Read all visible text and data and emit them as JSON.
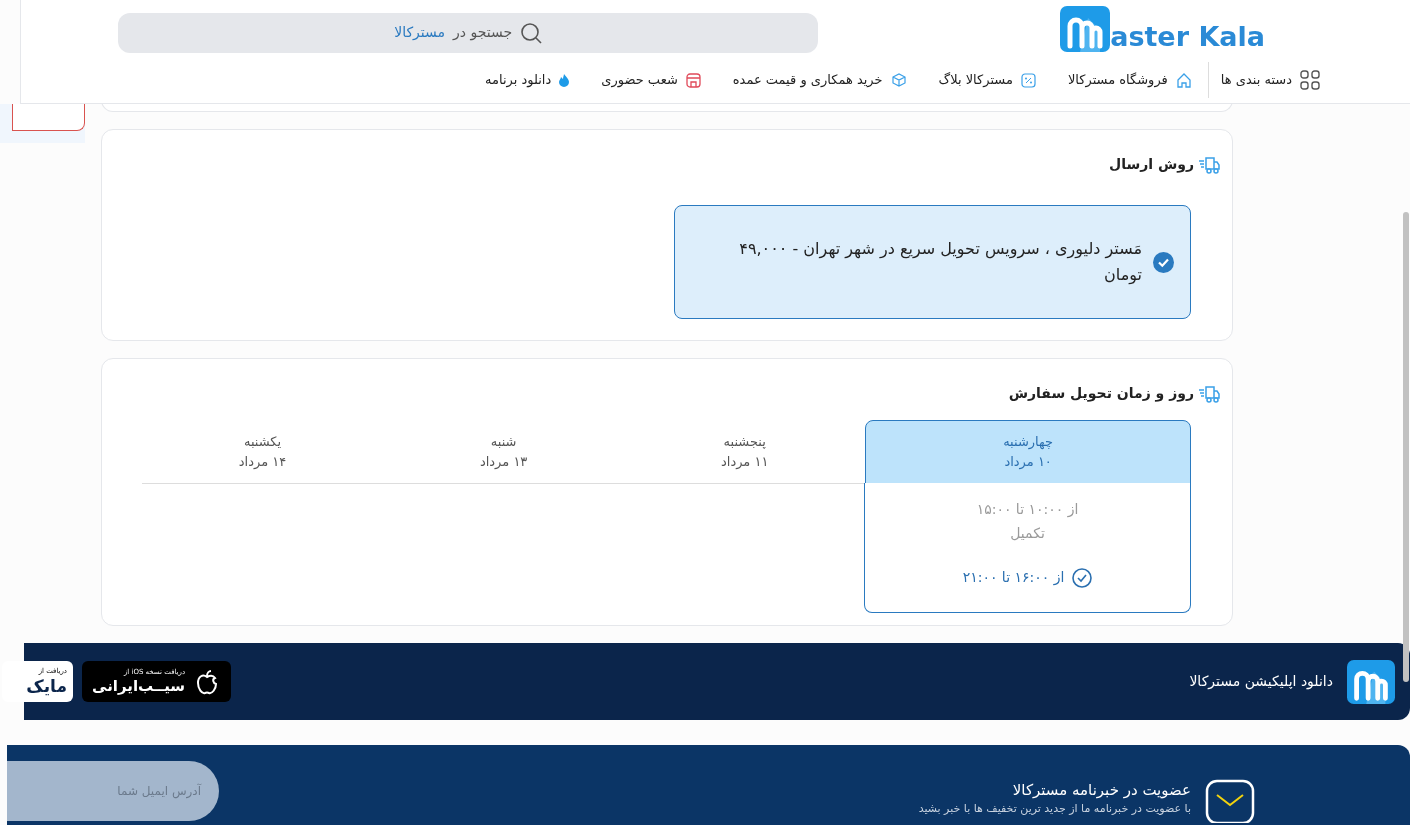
{
  "header": {
    "logo_text": "aster Kala",
    "search": {
      "placeholder": "جستجو در",
      "brand": "مسترکالا"
    },
    "nav": [
      {
        "kind": "grid",
        "label": "دسته بندی ها"
      },
      {
        "kind": "home",
        "label": "فروشگاه مسترکالا"
      },
      {
        "kind": "percent",
        "label": "مسترکالا بلاگ"
      },
      {
        "kind": "box",
        "label": "خرید همکاری و قیمت عمده"
      },
      {
        "kind": "store",
        "label": "شعب حضوری"
      },
      {
        "kind": "fire",
        "label": "دانلود برنامه"
      }
    ]
  },
  "shipping": {
    "title": "روش ارسال",
    "options": [
      {
        "label": "مَستر دلیوری ، سرویس تحویل سریع در شهر تهران - ۴۹,۰۰۰ تومان",
        "selected": true
      }
    ]
  },
  "delivery": {
    "title": "روز و زمان تحویل سفارش",
    "days": [
      {
        "day": "چهارشنبه",
        "date": "۱۰ مرداد",
        "selected": true
      },
      {
        "day": "پنجشنبه",
        "date": "۱۱ مرداد",
        "selected": false
      },
      {
        "day": "شنبه",
        "date": "۱۳ مرداد",
        "selected": false
      },
      {
        "day": "یکشنبه",
        "date": "۱۴ مرداد",
        "selected": false
      }
    ],
    "slots": [
      {
        "label": "از ۱۰:۰۰ تا ۱۵:۰۰",
        "status": "تکمیل",
        "disabled": true,
        "selected": false
      },
      {
        "label": "از ۱۶:۰۰ تا ۲۱:۰۰",
        "disabled": false,
        "selected": true
      }
    ]
  },
  "app_banner": {
    "title": "دانلود اپلیکیشن مسترکالا",
    "badges": [
      {
        "kind": "sibapp",
        "caption": "دریافت نسخه iOS از",
        "name": "سیــب‌ایرانی"
      },
      {
        "kind": "myket",
        "caption": "دریافت از",
        "name": "مایک"
      }
    ]
  },
  "newsletter": {
    "title": "عضویت در خبرنامه مسترکالا",
    "subtitle": "با عضویت در خبرنامه ما از جدید ترین تخفیف ها با خبر بشید",
    "email_placeholder": "آدرس ایمیل شما"
  }
}
